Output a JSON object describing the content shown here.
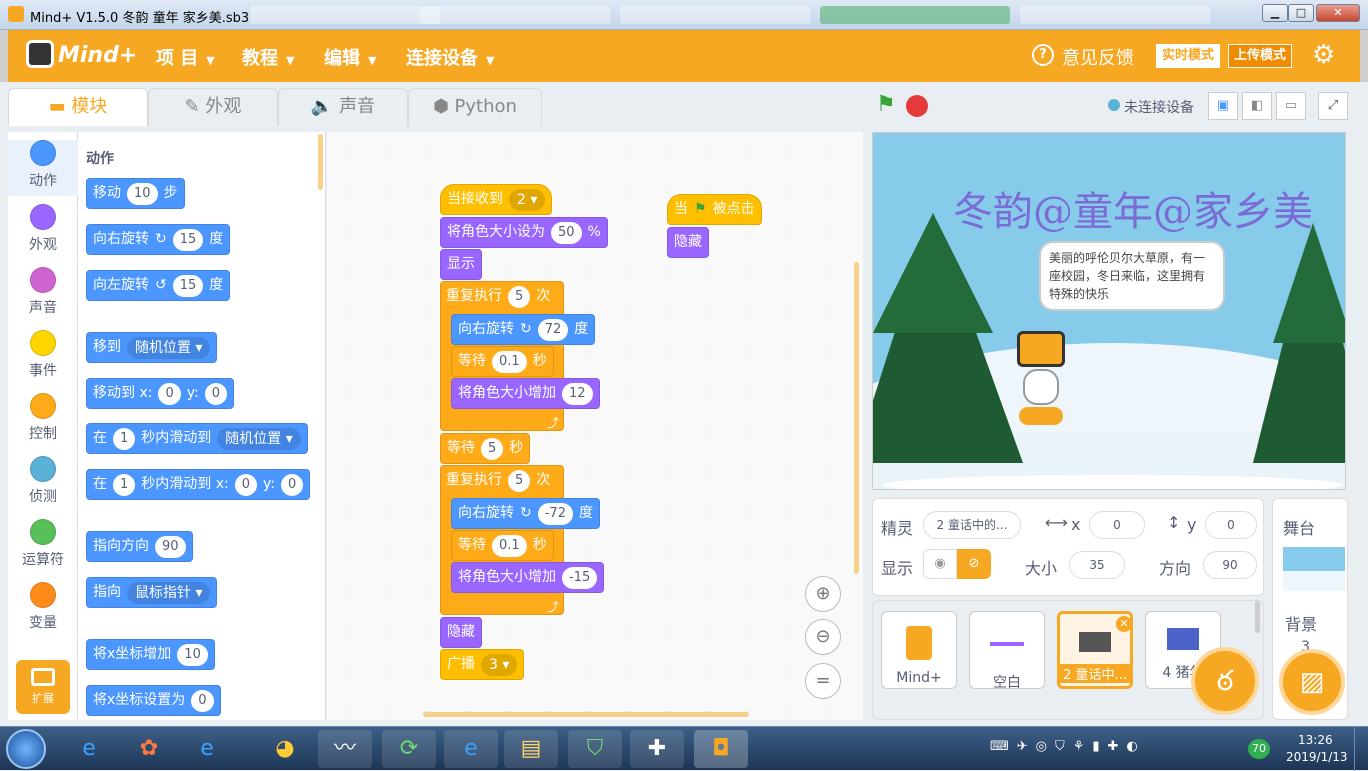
{
  "window": {
    "title": "Mind+ V1.5.0    冬韵 童年 家乡美.sb3",
    "min": "▁",
    "max": "□",
    "close": "✕"
  },
  "menubar": {
    "logo": "Mind+",
    "items": [
      "项 目",
      "教程",
      "编辑",
      "连接设备"
    ],
    "feedback": "意见反馈",
    "mode_live": "实时模式",
    "mode_upload": "上传模式"
  },
  "tabs": [
    "模块",
    "外观",
    "声音",
    "Python"
  ],
  "categories": [
    {
      "label": "动作",
      "color": "#4c97ff"
    },
    {
      "label": "外观",
      "color": "#9966ff"
    },
    {
      "label": "声音",
      "color": "#cf63cf"
    },
    {
      "label": "事件",
      "color": "#ffd500"
    },
    {
      "label": "控制",
      "color": "#ffab19"
    },
    {
      "label": "侦测",
      "color": "#5cb1d6"
    },
    {
      "label": "运算符",
      "color": "#59c059"
    },
    {
      "label": "变量",
      "color": "#ff8c1a"
    }
  ],
  "extension": "扩展",
  "palette": {
    "section": "动作",
    "b1": {
      "a": "移动",
      "v": "10",
      "b": "步"
    },
    "b2": {
      "a": "向右旋转",
      "v": "15",
      "b": "度"
    },
    "b3": {
      "a": "向左旋转",
      "v": "15",
      "b": "度"
    },
    "b4": {
      "a": "移到",
      "dd": "随机位置"
    },
    "b5": {
      "a": "移动到 x:",
      "x": "0",
      "b": "y:",
      "y": "0"
    },
    "b6": {
      "a": "在",
      "v": "1",
      "b": "秒内滑动到",
      "dd": "随机位置"
    },
    "b7": {
      "a": "在",
      "v": "1",
      "b": "秒内滑动到 x:",
      "x": "0",
      "c": "y:",
      "y": "0"
    },
    "b8": {
      "a": "指向方向",
      "v": "90"
    },
    "b9": {
      "a": "指向",
      "dd": "鼠标指针"
    },
    "b10": {
      "a": "将x坐标增加",
      "v": "10"
    },
    "b11": {
      "a": "将x坐标设置为",
      "v": "0"
    }
  },
  "script1": {
    "hat": {
      "a": "当接收到",
      "dd": "2"
    },
    "size": {
      "a": "将角色大小设为",
      "v": "50",
      "b": "%"
    },
    "show": "显示",
    "rep1": {
      "a": "重复执行",
      "v": "5",
      "b": "次"
    },
    "r1_turn": {
      "a": "向右旋转",
      "v": "72",
      "b": "度"
    },
    "r1_wait": {
      "a": "等待",
      "v": "0.1",
      "b": "秒"
    },
    "r1_grow": {
      "a": "将角色大小增加",
      "v": "12"
    },
    "wait": {
      "a": "等待",
      "v": "5",
      "b": "秒"
    },
    "rep2": {
      "a": "重复执行",
      "v": "5",
      "b": "次"
    },
    "r2_turn": {
      "a": "向右旋转",
      "v": "-72",
      "b": "度"
    },
    "r2_wait": {
      "a": "等待",
      "v": "0.1",
      "b": "秒"
    },
    "r2_grow": {
      "a": "将角色大小增加",
      "v": "-15"
    },
    "hide": "隐藏",
    "broadcast": {
      "a": "广播",
      "dd": "3"
    }
  },
  "script2": {
    "hat_a": "当",
    "hat_b": "被点击",
    "hide": "隐藏"
  },
  "zoom": {
    "in": "⊕",
    "out": "⊖",
    "reset": "="
  },
  "stagebar": {
    "status": "未连接设备"
  },
  "stage": {
    "title": "冬韵@童年@家乡美",
    "bubble": "美丽的呼伦贝尔大草原，有一座校园，冬日来临，这里拥有特殊的快乐"
  },
  "sprite_info": {
    "sprite_label": "精灵",
    "sprite_name": "2 童话中的...",
    "x_label": "x",
    "x": "0",
    "y_label": "y",
    "y": "0",
    "show_label": "显示",
    "size_label": "大小",
    "size": "35",
    "dir_label": "方向",
    "dir": "90"
  },
  "sprites": [
    "Mind+",
    "空白",
    "2 童话中...",
    "4 猪年"
  ],
  "stage_pane": {
    "title": "舞台",
    "backdrop_label": "背景",
    "backdrop_count": "3"
  },
  "taskbar": {
    "time": "13:26",
    "date": "2019/1/13",
    "badge": "70"
  }
}
